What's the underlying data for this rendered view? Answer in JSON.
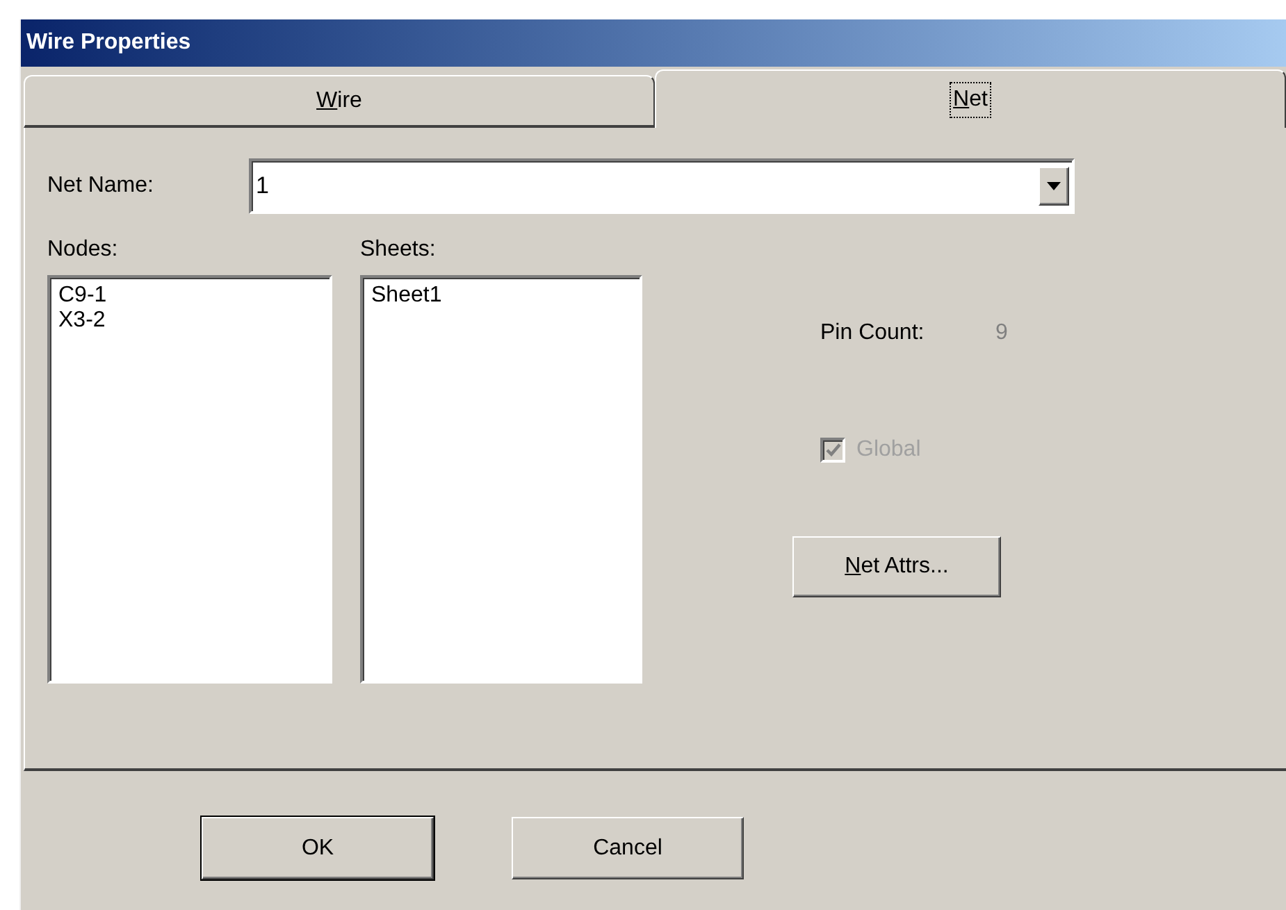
{
  "window": {
    "title": "Wire Properties"
  },
  "tabs": [
    {
      "label": "Wire",
      "underline_first": true,
      "selected": false
    },
    {
      "label": "Net",
      "underline_first": true,
      "selected": true
    }
  ],
  "net_name": {
    "label": "Net Name:",
    "value": "1"
  },
  "nodes": {
    "label": "Nodes:",
    "items": [
      "C9-1",
      "X3-2"
    ]
  },
  "sheets": {
    "label": "Sheets:",
    "items": [
      "Sheet1"
    ]
  },
  "pin_count": {
    "label": "Pin Count:",
    "value": "9",
    "disabled": true
  },
  "global": {
    "label": "Global",
    "checked": true,
    "disabled": true
  },
  "net_attrs_button": {
    "label": "Net Attrs...",
    "underline_first": true
  },
  "buttons": [
    {
      "label": "OK",
      "default": true
    },
    {
      "label": "Cancel",
      "default": false
    }
  ]
}
